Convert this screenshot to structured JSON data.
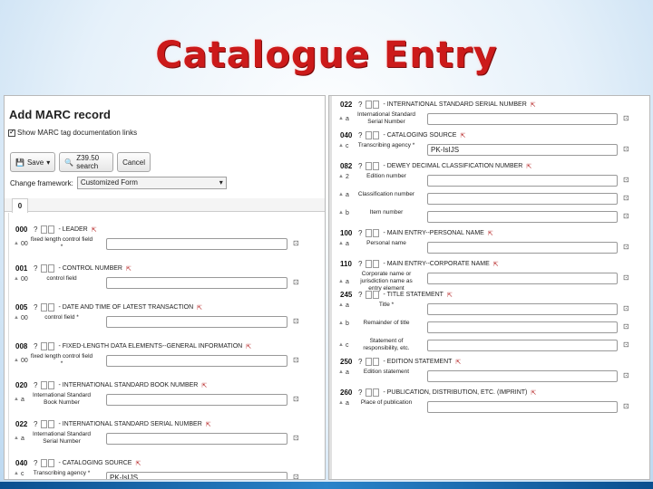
{
  "slide": {
    "title": "Catalogue Entry"
  },
  "left": {
    "heading": "Add MARC record",
    "show_marc_label": "Show MARC tag documentation links",
    "toolbar": {
      "save_label": "Save",
      "z3950_label": "Z39.50 search",
      "cancel_label": "Cancel"
    },
    "framework": {
      "label": "Change framework:",
      "value": "Customized Form"
    },
    "tab_label": "0",
    "tags": [
      {
        "code": "000",
        "label": "LEADER",
        "subs": [
          {
            "code": "00",
            "label": "fixed length control field *",
            "value": ""
          }
        ]
      },
      {
        "code": "001",
        "label": "CONTROL NUMBER",
        "subs": [
          {
            "code": "00",
            "label": "control field",
            "value": ""
          }
        ]
      },
      {
        "code": "005",
        "label": "DATE AND TIME OF LATEST TRANSACTION",
        "subs": [
          {
            "code": "00",
            "label": "control field *",
            "value": ""
          }
        ]
      },
      {
        "code": "008",
        "label": "FIXED-LENGTH DATA ELEMENTS--GENERAL INFORMATION",
        "subs": [
          {
            "code": "00",
            "label": "fixed length control field *",
            "value": ""
          }
        ]
      },
      {
        "code": "020",
        "label": "INTERNATIONAL STANDARD BOOK NUMBER",
        "subs": [
          {
            "code": "a",
            "label": "International Standard Book Number",
            "value": ""
          }
        ]
      },
      {
        "code": "022",
        "label": "INTERNATIONAL STANDARD SERIAL NUMBER",
        "subs": [
          {
            "code": "a",
            "label": "International Standard Serial Number",
            "value": ""
          }
        ]
      },
      {
        "code": "040",
        "label": "CATALOGING SOURCE",
        "subs": [
          {
            "code": "c",
            "label": "Transcribing agency *",
            "value": "PK-IsIJS"
          }
        ]
      }
    ]
  },
  "right": {
    "tags": [
      {
        "code": "022",
        "label": "INTERNATIONAL STANDARD SERIAL NUMBER",
        "subs": [
          {
            "code": "a",
            "label": "International Standard Serial Number",
            "value": ""
          }
        ]
      },
      {
        "code": "040",
        "label": "CATALOGING SOURCE",
        "subs": [
          {
            "code": "c",
            "label": "Transcribing agency *",
            "value": "PK-IsIJS"
          }
        ]
      },
      {
        "code": "082",
        "label": "DEWEY DECIMAL CLASSIFICATION NUMBER",
        "subs": [
          {
            "code": "2",
            "label": "Edition number",
            "value": ""
          },
          {
            "code": "a",
            "label": "Classification number",
            "value": ""
          },
          {
            "code": "b",
            "label": "Item number",
            "value": ""
          }
        ]
      },
      {
        "code": "100",
        "label": "MAIN ENTRY--PERSONAL NAME",
        "subs": [
          {
            "code": "a",
            "label": "Personal name",
            "value": ""
          }
        ]
      },
      {
        "code": "110",
        "label": "MAIN ENTRY--CORPORATE NAME",
        "subs": [
          {
            "code": "a",
            "label": "Corporate name or jurisdiction name as entry element",
            "value": ""
          }
        ]
      },
      {
        "code": "245",
        "label": "TITLE STATEMENT",
        "subs": [
          {
            "code": "a",
            "label": "Title *",
            "value": ""
          },
          {
            "code": "b",
            "label": "Remainder of title",
            "value": ""
          },
          {
            "code": "c",
            "label": "Statement of responsibility, etc.",
            "value": ""
          }
        ]
      },
      {
        "code": "250",
        "label": "EDITION STATEMENT",
        "subs": [
          {
            "code": "a",
            "label": "Edition statement",
            "value": ""
          }
        ]
      },
      {
        "code": "260",
        "label": "PUBLICATION, DISTRIBUTION, ETC. (IMPRINT)",
        "subs": [
          {
            "code": "a",
            "label": "Place of publication",
            "value": ""
          }
        ]
      }
    ]
  }
}
